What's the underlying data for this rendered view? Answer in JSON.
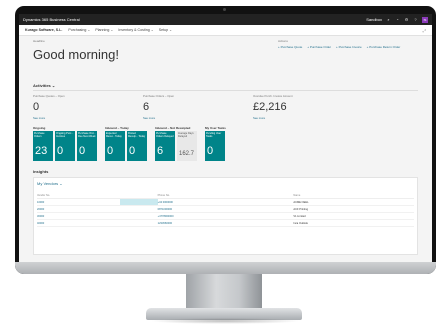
{
  "topbar": {
    "app_title": "Dynamics 365 Business Central",
    "env": "Sandbox",
    "icons": [
      "search-icon",
      "bell-icon",
      "gear-icon",
      "help-icon"
    ],
    "avatar": "IS"
  },
  "navbar": {
    "company": "Kurago Software, S.L.",
    "items": [
      "Purchasing ⌄",
      "Planning ⌄",
      "Inventory & Costing ⌄",
      "Setup ⌄"
    ]
  },
  "head": {
    "caption": "Headline",
    "greeting": "Good morning!",
    "actions_title": "Actions",
    "actions": [
      "+ Purchase Quote",
      "+ Purchase Order",
      "+ Purchase Invoice",
      "+ Purchase Return Order"
    ]
  },
  "activities": {
    "title": "Activities ⌄",
    "kpis": [
      {
        "label": "Purchase Quotes – Open",
        "value": "0",
        "link": "See more"
      },
      {
        "label": "Purchase Orders – Open",
        "value": "6",
        "link": "See more"
      },
      {
        "label": "Overdue Purch. Invoice Amount",
        "value": "£2,216",
        "link": "See more"
      }
    ]
  },
  "tile_groups": [
    {
      "title": "Ongoing",
      "tiles": [
        {
          "label": "Purchase Orders",
          "value": "23",
          "grey": false
        },
        {
          "label": "Ongoing Purc... Invoices",
          "value": "0",
          "grey": false
        },
        {
          "label": "Purchase Ord... Due Next Week",
          "value": "0",
          "grey": false
        }
      ]
    },
    {
      "title": "Inbound – Today",
      "tiles": [
        {
          "label": "Expected Recei... Today",
          "value": "0",
          "grey": false
        },
        {
          "label": "Posted Receip... Today",
          "value": "0",
          "grey": false
        }
      ]
    },
    {
      "title": "Inbound – Not Receipted",
      "tiles": [
        {
          "label": "Purchase Orders Delayed",
          "value": "6",
          "grey": false
        },
        {
          "label": "Average Days Delayed",
          "value": "162.7",
          "grey": true
        }
      ]
    },
    {
      "title": "My User Tasks",
      "tiles": [
        {
          "label": "Pending User Tasks",
          "value": "0",
          "grey": false
        }
      ]
    }
  ],
  "insights": {
    "title": "Insights",
    "panel_title": "My Vendors ⌄",
    "columns": [
      "Vendor No.",
      "",
      "Phone No.",
      "Name"
    ],
    "rows": [
      {
        "no": "10000",
        "phone": "+34 0000000",
        "name": "ACME OEHL"
      },
      {
        "no": "20000",
        "phone": "0871000000",
        "name": "ACF Printing"
      },
      {
        "no": "30000",
        "phone": "+4778000000",
        "name": "V1 Limited"
      },
      {
        "no": "40000",
        "phone": "1234560000",
        "name": "Inca Outlook"
      }
    ]
  }
}
